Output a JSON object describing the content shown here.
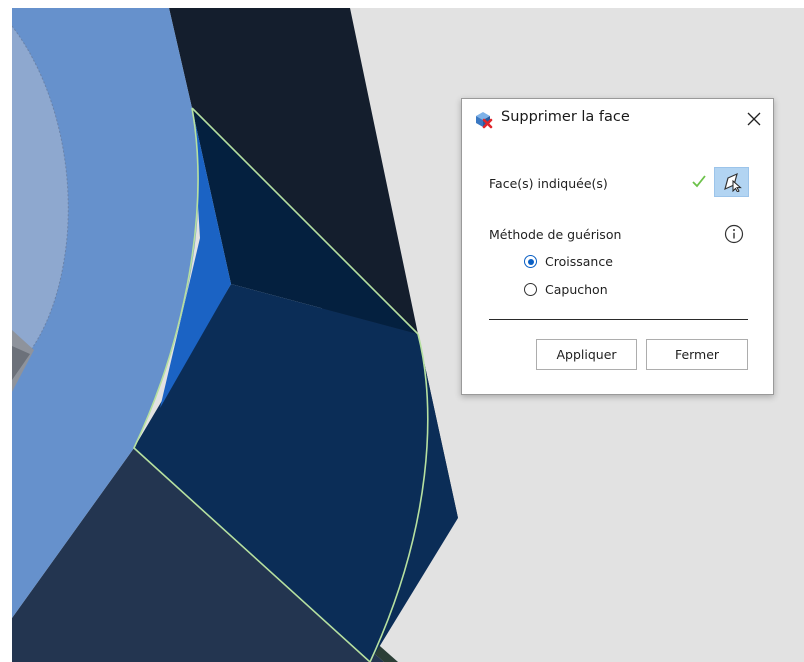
{
  "dialog": {
    "title": "Supprimer la face",
    "title_icon": "delete-face-icon",
    "close_icon": "close-icon",
    "faces_label": "Face(s) indiquée(s)",
    "faces_status_icon": "checkmark-icon",
    "faces_select_icon": "face-select-cursor-icon",
    "method_label": "Méthode de guérison",
    "info_icon": "info-icon",
    "options": [
      {
        "label": "Croissance",
        "selected": true
      },
      {
        "label": "Capuchon",
        "selected": false
      }
    ],
    "apply_label": "Appliquer",
    "close_label": "Fermer"
  },
  "colors": {
    "viewport_bg": "#e2e2e2",
    "light_blue_face": "#6490cb",
    "dark_navy": "#141e2d",
    "mid_navy": "#0b2547",
    "deep_navy": "#042140",
    "slate": "#233550",
    "bright_blue": "#1a63c6",
    "highlight_edge": "#b6e0a0",
    "check_green": "#6cc24a",
    "select_bg": "#b2d4f2"
  }
}
